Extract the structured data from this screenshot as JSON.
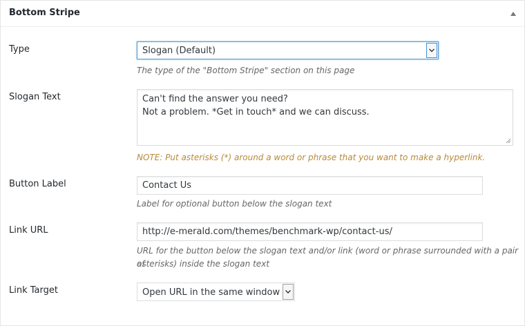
{
  "panel": {
    "title": "Bottom Stripe",
    "toggle_icon": "triangle-up-icon"
  },
  "fields": {
    "type": {
      "label": "Type",
      "value": "Slogan (Default)",
      "description": "The type of the \"Bottom Stripe\" section on this page"
    },
    "slogan_text": {
      "label": "Slogan Text",
      "lines": [
        "Can't find the answer you need?",
        "Not a problem. *Get in touch* and we can discuss."
      ],
      "note": "NOTE: Put asterisks (*) around a word or phrase that you want to make a hyperlink."
    },
    "button_label": {
      "label": "Button Label",
      "value": "Contact Us",
      "description": "Label for optional button below the slogan text"
    },
    "link_url": {
      "label": "Link URL",
      "value": "http://e-merald.com/themes/benchmark-wp/contact-us/",
      "description_line1": "URL for the button below the slogan text and/or link (word or phrase surrounded with a pair of",
      "description_line2": "asterisks) inside the slogan text"
    },
    "link_target": {
      "label": "Link Target",
      "value": "Open URL in the same window"
    }
  },
  "colors": {
    "note": "#b78a3a",
    "focus_border": "#5b9dd9"
  }
}
